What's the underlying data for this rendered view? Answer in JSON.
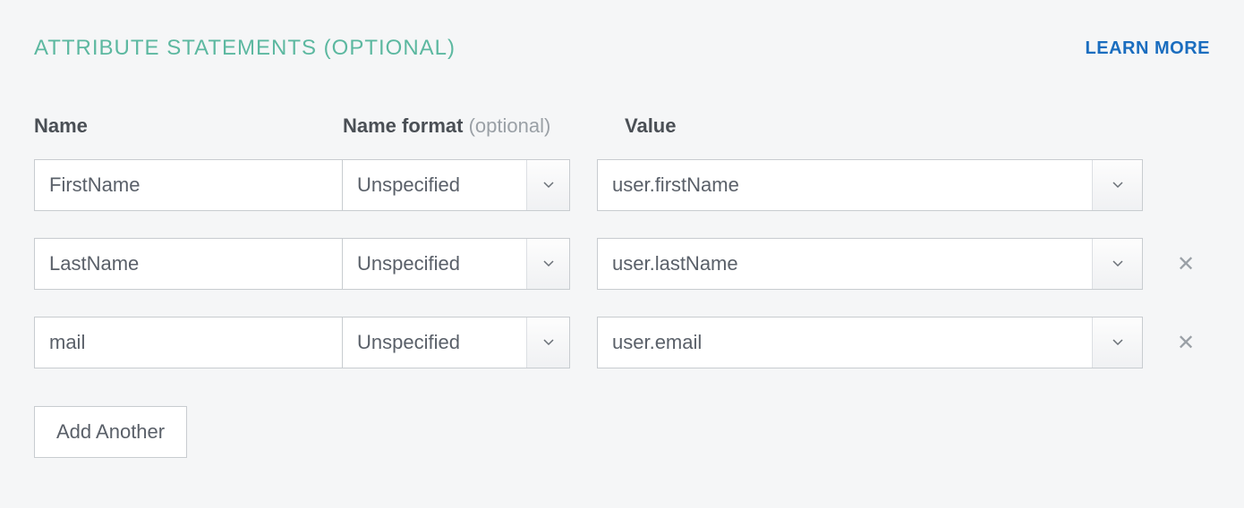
{
  "section": {
    "title": "ATTRIBUTE STATEMENTS (OPTIONAL)",
    "learn_more": "LEARN MORE"
  },
  "columns": {
    "name": "Name",
    "format": "Name format",
    "format_optional": "(optional)",
    "value": "Value"
  },
  "rows": [
    {
      "name": "FirstName",
      "format": "Unspecified",
      "value": "user.firstName",
      "removable": false
    },
    {
      "name": "LastName",
      "format": "Unspecified",
      "value": "user.lastName",
      "removable": true
    },
    {
      "name": "mail",
      "format": "Unspecified",
      "value": "user.email",
      "removable": true
    }
  ],
  "add_button": "Add Another"
}
